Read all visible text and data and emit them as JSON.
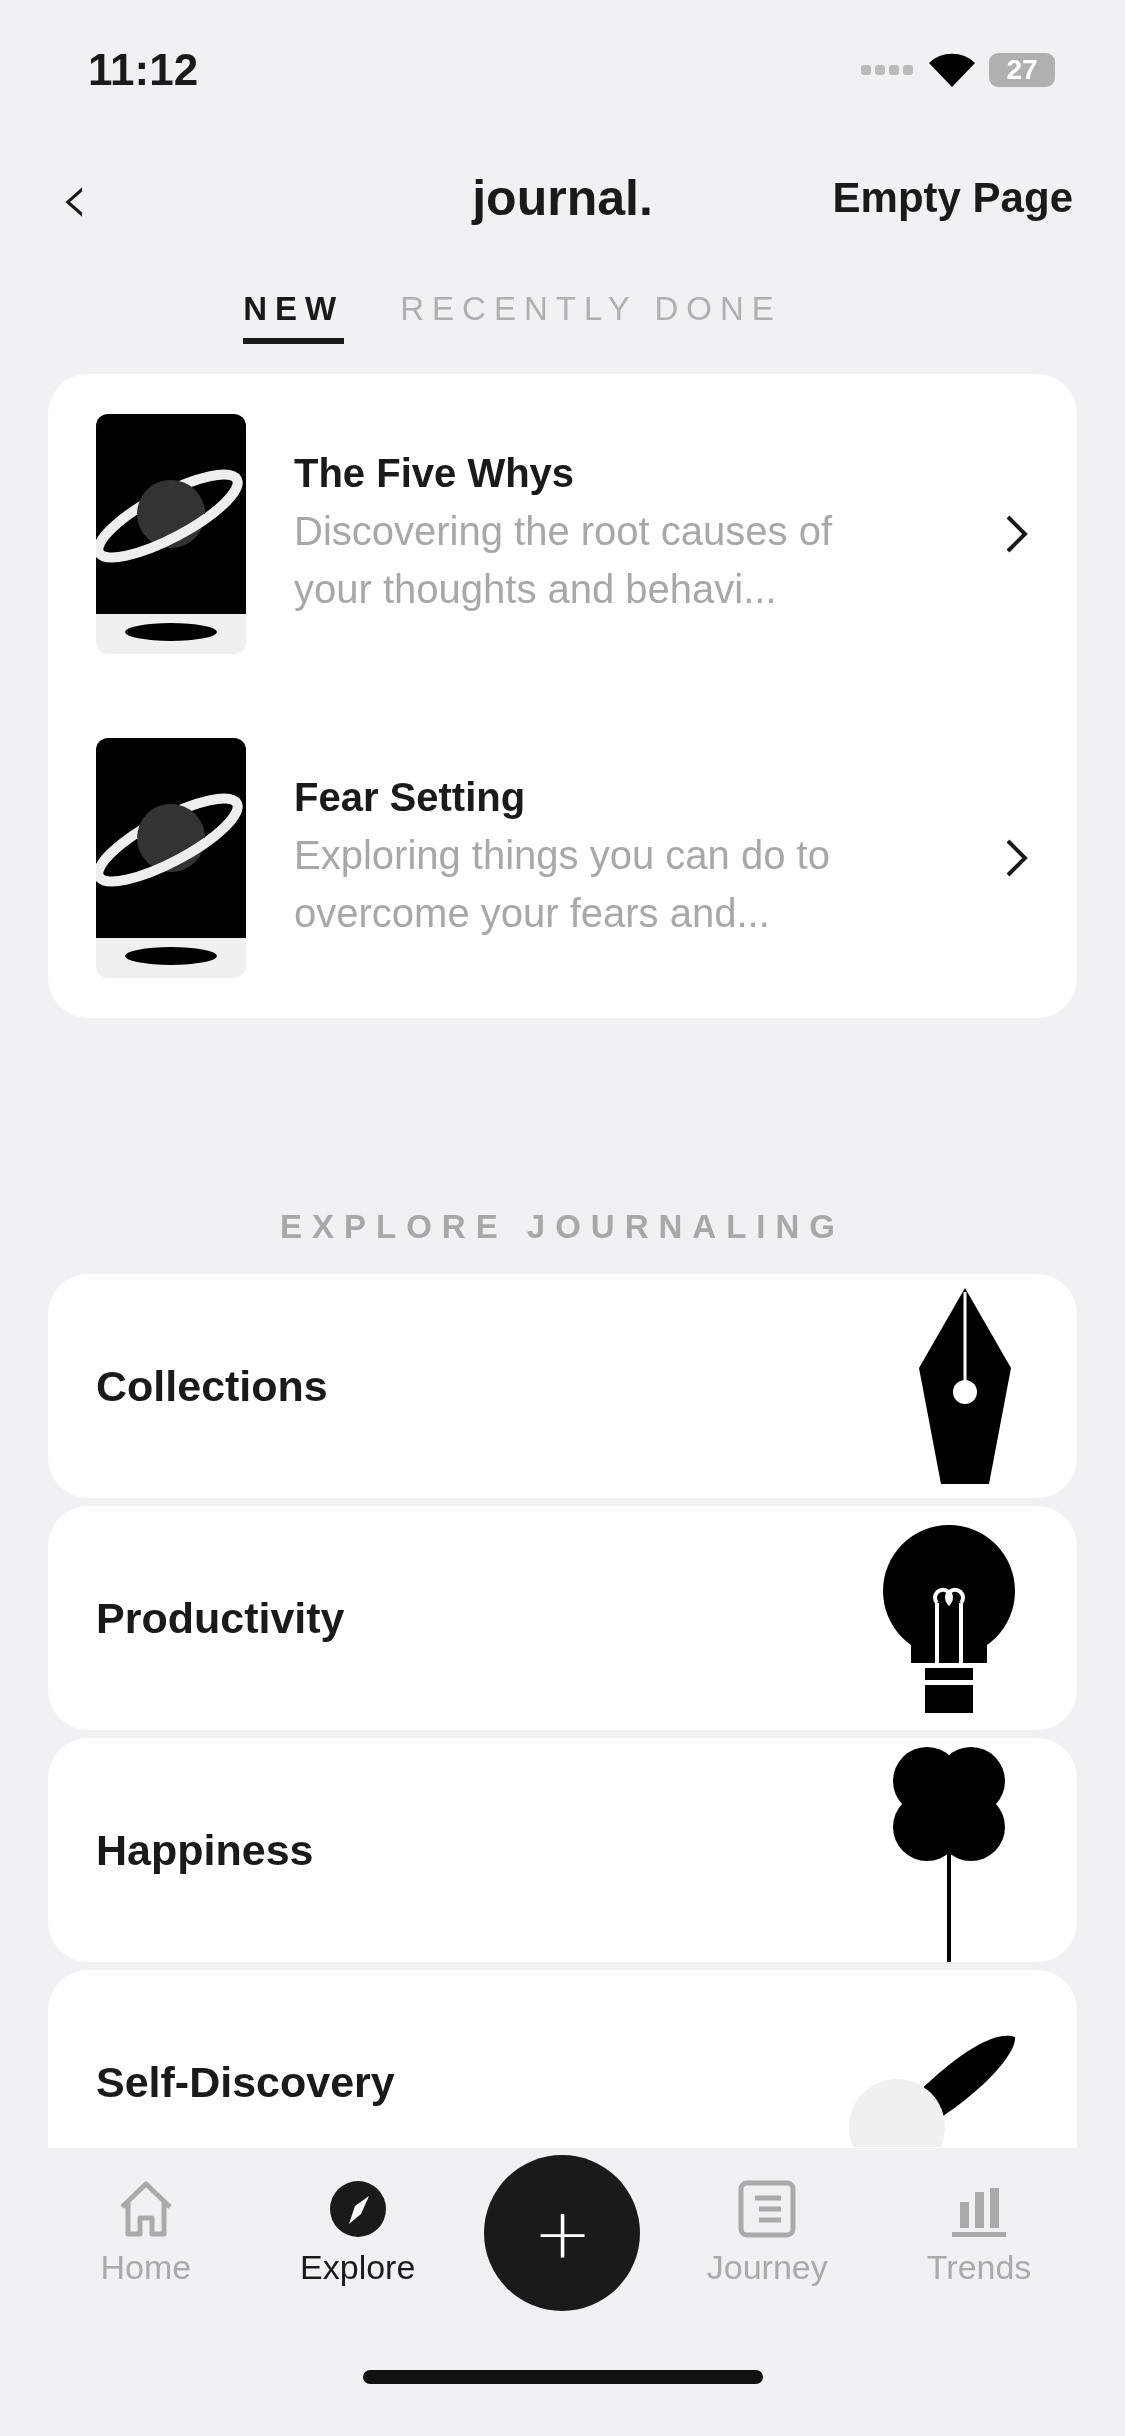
{
  "status_bar": {
    "time": "11:12",
    "battery": "27"
  },
  "header": {
    "back": "‹",
    "title": "journal.",
    "action": "Empty Page"
  },
  "tabs": [
    {
      "label": "NEW",
      "selected": true
    },
    {
      "label": "RECENTLY DONE",
      "selected": false
    }
  ],
  "prompts": [
    {
      "title": "The Five Whys",
      "description": "Discovering the root causes of your thoughts and behavi..."
    },
    {
      "title": "Fear Setting",
      "description": "Exploring things you can do to overcome your fears and..."
    }
  ],
  "explore": {
    "heading": "EXPLORE JOURNALING",
    "categories": [
      {
        "label": "Collections"
      },
      {
        "label": "Productivity"
      },
      {
        "label": "Happiness"
      },
      {
        "label": "Self-Discovery"
      }
    ]
  },
  "nav": [
    {
      "label": "Home",
      "selected": false
    },
    {
      "label": "Explore",
      "selected": true
    },
    {
      "label": "Journey",
      "selected": false
    },
    {
      "label": "Trends",
      "selected": false
    }
  ],
  "add_button": "+"
}
